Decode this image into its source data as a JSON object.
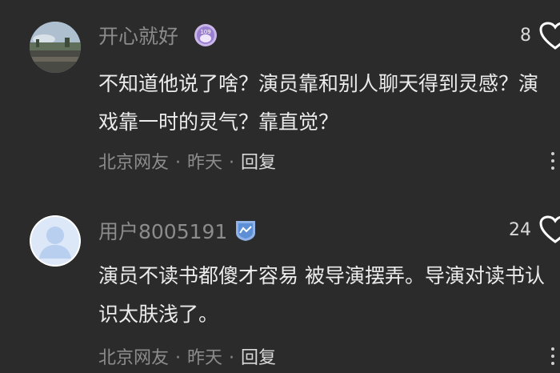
{
  "comments": [
    {
      "username": "开心就好",
      "badge_icon": "level-badge-icon",
      "badge_text": "109",
      "likes": "8",
      "text": "不知道他说了啥？演员靠和别人聊天得到灵感？演戏靠一时的灵气？靠直觉？",
      "location": "北京网友",
      "time": "昨天",
      "reply_label": "回复",
      "separator": "·"
    },
    {
      "username": "用户8005191",
      "badge_icon": "shield-badge-icon",
      "likes": "24",
      "text": "演员不读书都傻才容易 被导演摆弄。导演对读书认识太肤浅了。",
      "location": "北京网友",
      "time": "昨天",
      "reply_label": "回复",
      "separator": "·"
    }
  ]
}
